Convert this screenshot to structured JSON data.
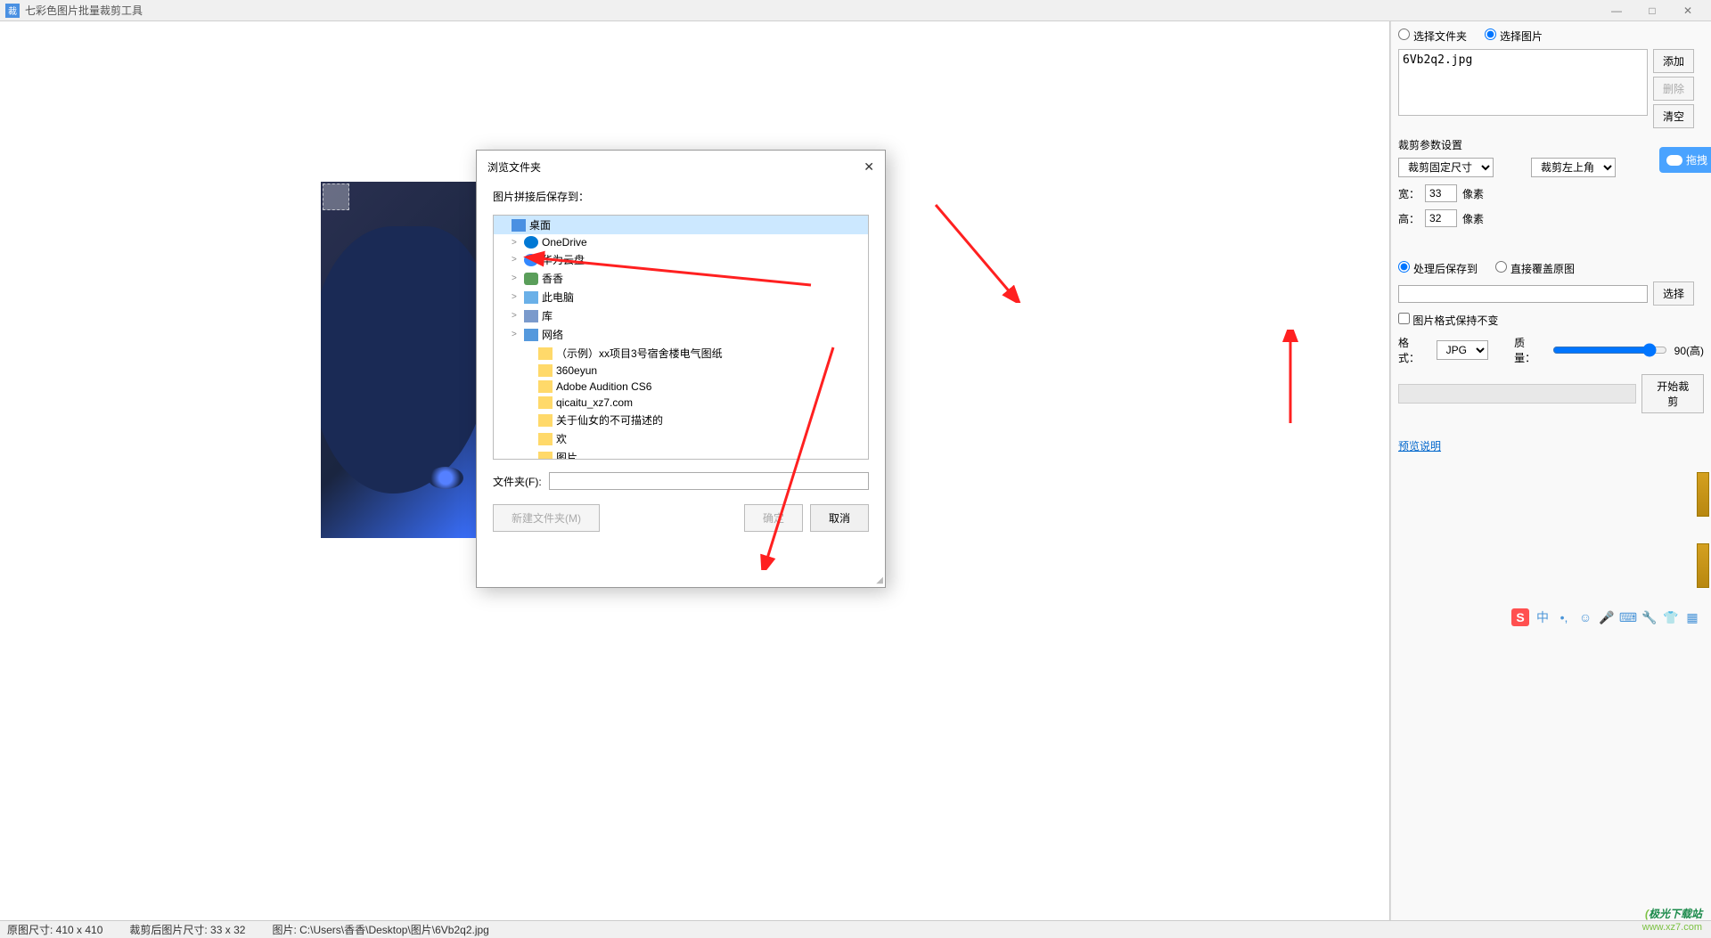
{
  "app": {
    "title": "七彩色图片批量裁剪工具",
    "icon_text": "裁"
  },
  "right_panel": {
    "source_mode": {
      "folder": "选择文件夹",
      "image": "选择图片"
    },
    "file_list_content": "6Vb2q2.jpg",
    "buttons": {
      "add": "添加",
      "delete": "删除",
      "clear": "清空"
    },
    "crop_section": "裁剪参数设置",
    "crop_mode": "裁剪固定尺寸",
    "crop_anchor": "裁剪左上角",
    "width_label": "宽：",
    "width_val": "33",
    "width_unit": "像素",
    "height_label": "高：",
    "height_val": "32",
    "height_unit": "像素",
    "save_mode": {
      "save_to": "处理后保存到",
      "overwrite": "直接覆盖原图"
    },
    "save_path": "",
    "select_btn": "选择",
    "keep_format": "图片格式保持不变",
    "format_label": "格式：",
    "format_val": "JPG",
    "quality_label": "质量：",
    "quality_val": "90(高)",
    "start_btn": "开始裁剪",
    "preview_link": "预览说明",
    "cloud_drag": "拖拽"
  },
  "dialog": {
    "title": "浏览文件夹",
    "save_to_label": "图片拼接后保存到：",
    "tree": [
      {
        "label": "桌面",
        "icon": "desktop",
        "depth": 0,
        "selected": true
      },
      {
        "label": "OneDrive",
        "icon": "onedrive",
        "depth": 1,
        "expand": ">"
      },
      {
        "label": "华为云盘",
        "icon": "huawei",
        "depth": 1,
        "expand": ">"
      },
      {
        "label": "香香",
        "icon": "user",
        "depth": 1,
        "expand": ">"
      },
      {
        "label": "此电脑",
        "icon": "pc",
        "depth": 1,
        "expand": ">"
      },
      {
        "label": "库",
        "icon": "lib",
        "depth": 1,
        "expand": ">"
      },
      {
        "label": "网络",
        "icon": "net",
        "depth": 1,
        "expand": ">"
      },
      {
        "label": "（示例）xx项目3号宿舍楼电气图纸",
        "icon": "folder",
        "depth": 2
      },
      {
        "label": "360eyun",
        "icon": "folder",
        "depth": 2
      },
      {
        "label": "Adobe Audition CS6",
        "icon": "folder",
        "depth": 2
      },
      {
        "label": "qicaitu_xz7.com",
        "icon": "folder",
        "depth": 2
      },
      {
        "label": "关于仙女的不可描述的",
        "icon": "folder",
        "depth": 2
      },
      {
        "label": "欢",
        "icon": "folder",
        "depth": 2
      },
      {
        "label": "图片",
        "icon": "folder",
        "depth": 2
      }
    ],
    "folder_label": "文件夹(F):",
    "folder_value": "",
    "new_folder_btn": "新建文件夹(M)",
    "ok_btn": "确定",
    "cancel_btn": "取消"
  },
  "statusbar": {
    "orig": "原图尺寸: 410 x 410",
    "cropped": "裁剪后图片尺寸: 33 x 32",
    "path": "图片: C:\\Users\\香香\\Desktop\\图片\\6Vb2q2.jpg"
  },
  "ime": {
    "cn": "中",
    "dot": "•,"
  },
  "watermark": {
    "name": "极光下载站",
    "url": "www.xz7.com"
  }
}
